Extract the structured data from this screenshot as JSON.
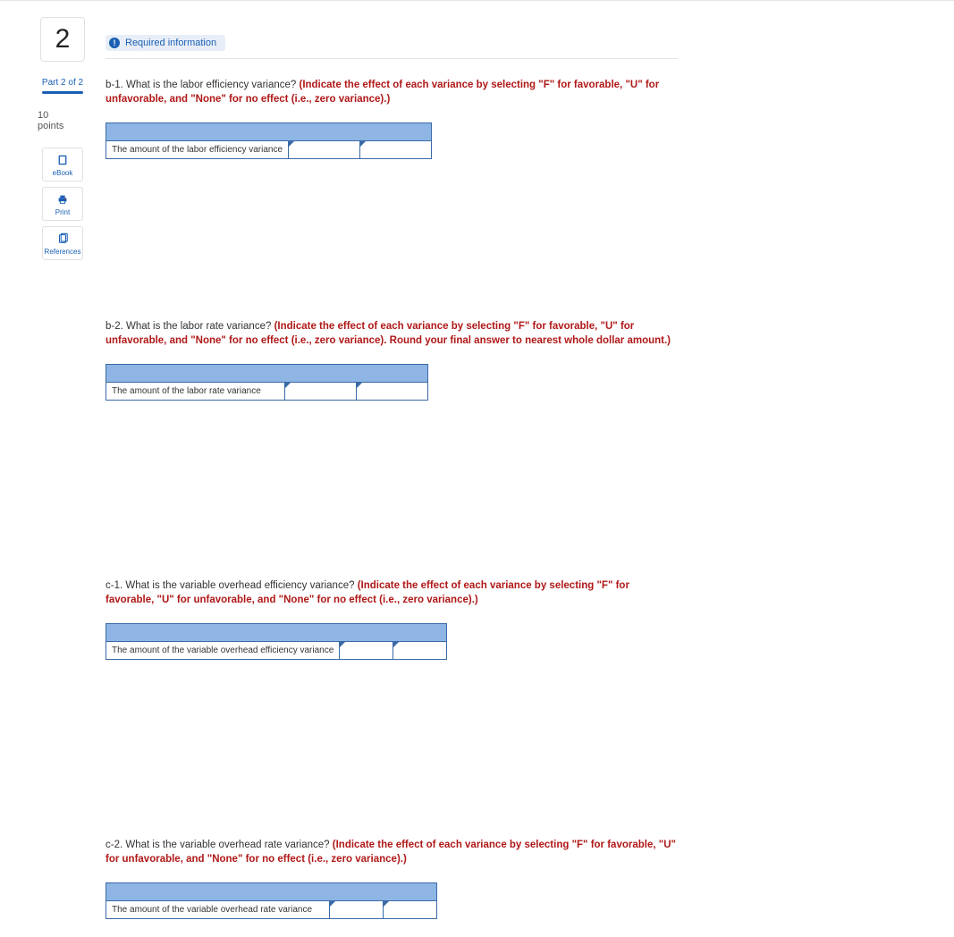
{
  "sidebar": {
    "question_number": "2",
    "part_label": "Part 2 of 2",
    "points_number": "10",
    "points_label": "points",
    "buttons": {
      "ebook": "eBook",
      "print": "Print",
      "references": "References"
    }
  },
  "header": {
    "required_badge": "!",
    "required_text": "Required information"
  },
  "questions": [
    {
      "id": "b1",
      "prompt": "b-1. What is the labor efficiency variance? ",
      "instruction": "(Indicate the effect of each variance by selecting \"F\" for favorable, \"U\" for unfavorable, and \"None\" for no effect (i.e., zero variance).)",
      "row_label": "The amount of the labor efficiency variance",
      "label_width": 200,
      "input1_width": 80,
      "input2_width": 80,
      "spacer_width": 75
    },
    {
      "id": "b2",
      "prompt": "b-2. What is the labor rate variance? ",
      "instruction": "(Indicate the effect of each variance by selecting \"F\" for favorable, \"U\" for unfavorable, and \"None\" for no effect (i.e., zero variance). Round your final answer to nearest whole dollar amount.)",
      "row_label": "The amount of the labor rate variance",
      "label_width": 200,
      "input1_width": 80,
      "input2_width": 80,
      "spacer_width": 75
    },
    {
      "id": "c1",
      "prompt": "c-1. What is the variable overhead efficiency variance? ",
      "instruction": "(Indicate the effect of each variance by selecting \"F\" for favorable, \"U\" for unfavorable, and \"None\" for no effect (i.e., zero variance).)",
      "row_label": "The amount of the variable overhead efficiency variance",
      "label_width": 250,
      "input1_width": 60,
      "input2_width": 60,
      "spacer_width": 100
    },
    {
      "id": "c2",
      "prompt": "c-2. What is the variable overhead rate variance? ",
      "instruction": "(Indicate the effect of each variance by selecting \"F\" for favorable, \"U\" for unfavorable, and \"None\" for no effect (i.e., zero variance).)",
      "row_label": "The amount of the variable overhead rate variance",
      "label_width": 250,
      "input1_width": 60,
      "input2_width": 60,
      "spacer_width": 100
    }
  ]
}
